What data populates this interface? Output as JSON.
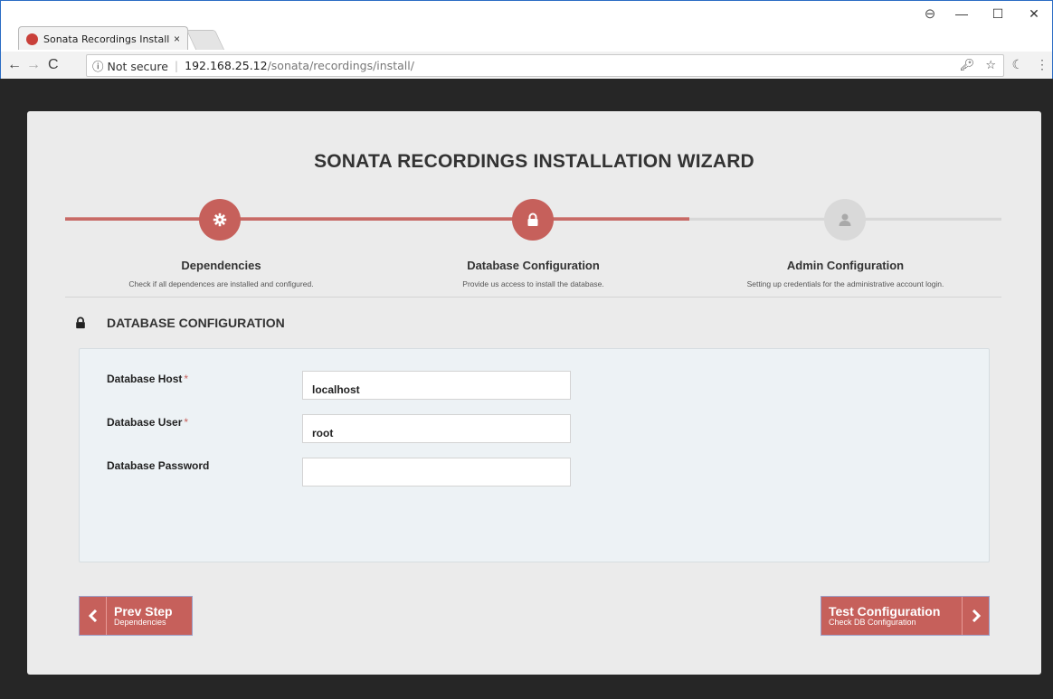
{
  "browser": {
    "tab_title": "Sonata Recordings Install",
    "tab_close": "×",
    "security_label": "ⓘ Not secure",
    "separator": "|",
    "url_host": "192.168.25.12",
    "url_path": "/sonata/recordings/install/",
    "window_controls": {
      "minimize": "—",
      "maximize": "☐",
      "close": "✕",
      "account": "⊖"
    }
  },
  "wizard": {
    "title": "SONATA RECORDINGS INSTALLATION WIZARD",
    "progress_fraction": 0.667,
    "steps": [
      {
        "name": "Dependencies",
        "description": "Check if all dependences are installed and configured.",
        "icon": "gear-icon",
        "state": "complete"
      },
      {
        "name": "Database Configuration",
        "description": "Provide us access to install the database.",
        "icon": "lock-icon",
        "state": "active"
      },
      {
        "name": "Admin Configuration",
        "description": "Setting up credentials for the administrative account login.",
        "icon": "user-icon",
        "state": "pending"
      }
    ]
  },
  "section": {
    "title": "DATABASE CONFIGURATION",
    "icon": "lock-icon"
  },
  "form": {
    "fields": [
      {
        "label": "Database Host",
        "required_mark": "*",
        "value": "localhost"
      },
      {
        "label": "Database User",
        "required_mark": "*",
        "value": "root"
      },
      {
        "label": "Database Password",
        "required_mark": "",
        "value": ""
      }
    ]
  },
  "buttons": {
    "prev": {
      "label": "Prev Step",
      "sub": "Dependencies"
    },
    "next": {
      "label": "Test Configuration",
      "sub": "Check DB Configuration"
    }
  },
  "colors": {
    "accent": "#c6605b",
    "page_background": "#262626",
    "card_background": "#ebebeb",
    "form_background": "#edf2f5"
  }
}
